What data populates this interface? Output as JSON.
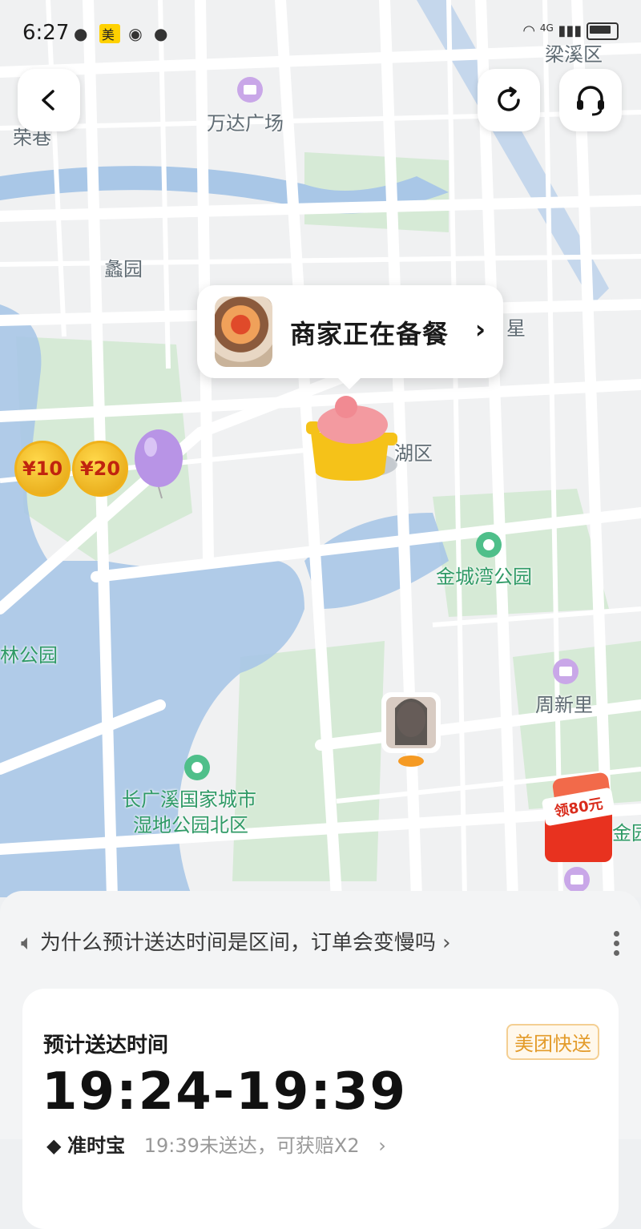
{
  "status_bar": {
    "time": "6:27",
    "app_badge": "美",
    "network": "4G"
  },
  "map": {
    "labels": {
      "liangxi": "梁溪区",
      "wanda": "万达广场",
      "rongxiang": "荣巷",
      "liyuan": "蠡园",
      "xing": "星",
      "hu": "湖区",
      "jincheng": "金城湾公园",
      "zhouxinli": "周新里",
      "gongyuan_left": "林公园",
      "changguangxi_1": "长广溪国家城市",
      "changguangxi_2": "湿地公园北区",
      "jin_right": "金园"
    },
    "coins": [
      "¥10",
      "¥20"
    ],
    "coupon_text": "领80元"
  },
  "popup": {
    "text": "商家正在备餐"
  },
  "notice": {
    "text": "为什么预计送达时间是区间，订单会变慢吗"
  },
  "card": {
    "label": "预计送达时间",
    "badge": "美团快送",
    "eta": "19:24-19:39",
    "ontime_label": "准时宝",
    "ontime_detail": "19:39未送达，可获赔X2"
  },
  "colors": {
    "accent": "#e39b2a",
    "map_water": "#aac7e6",
    "map_green": "#d4e9d4"
  }
}
